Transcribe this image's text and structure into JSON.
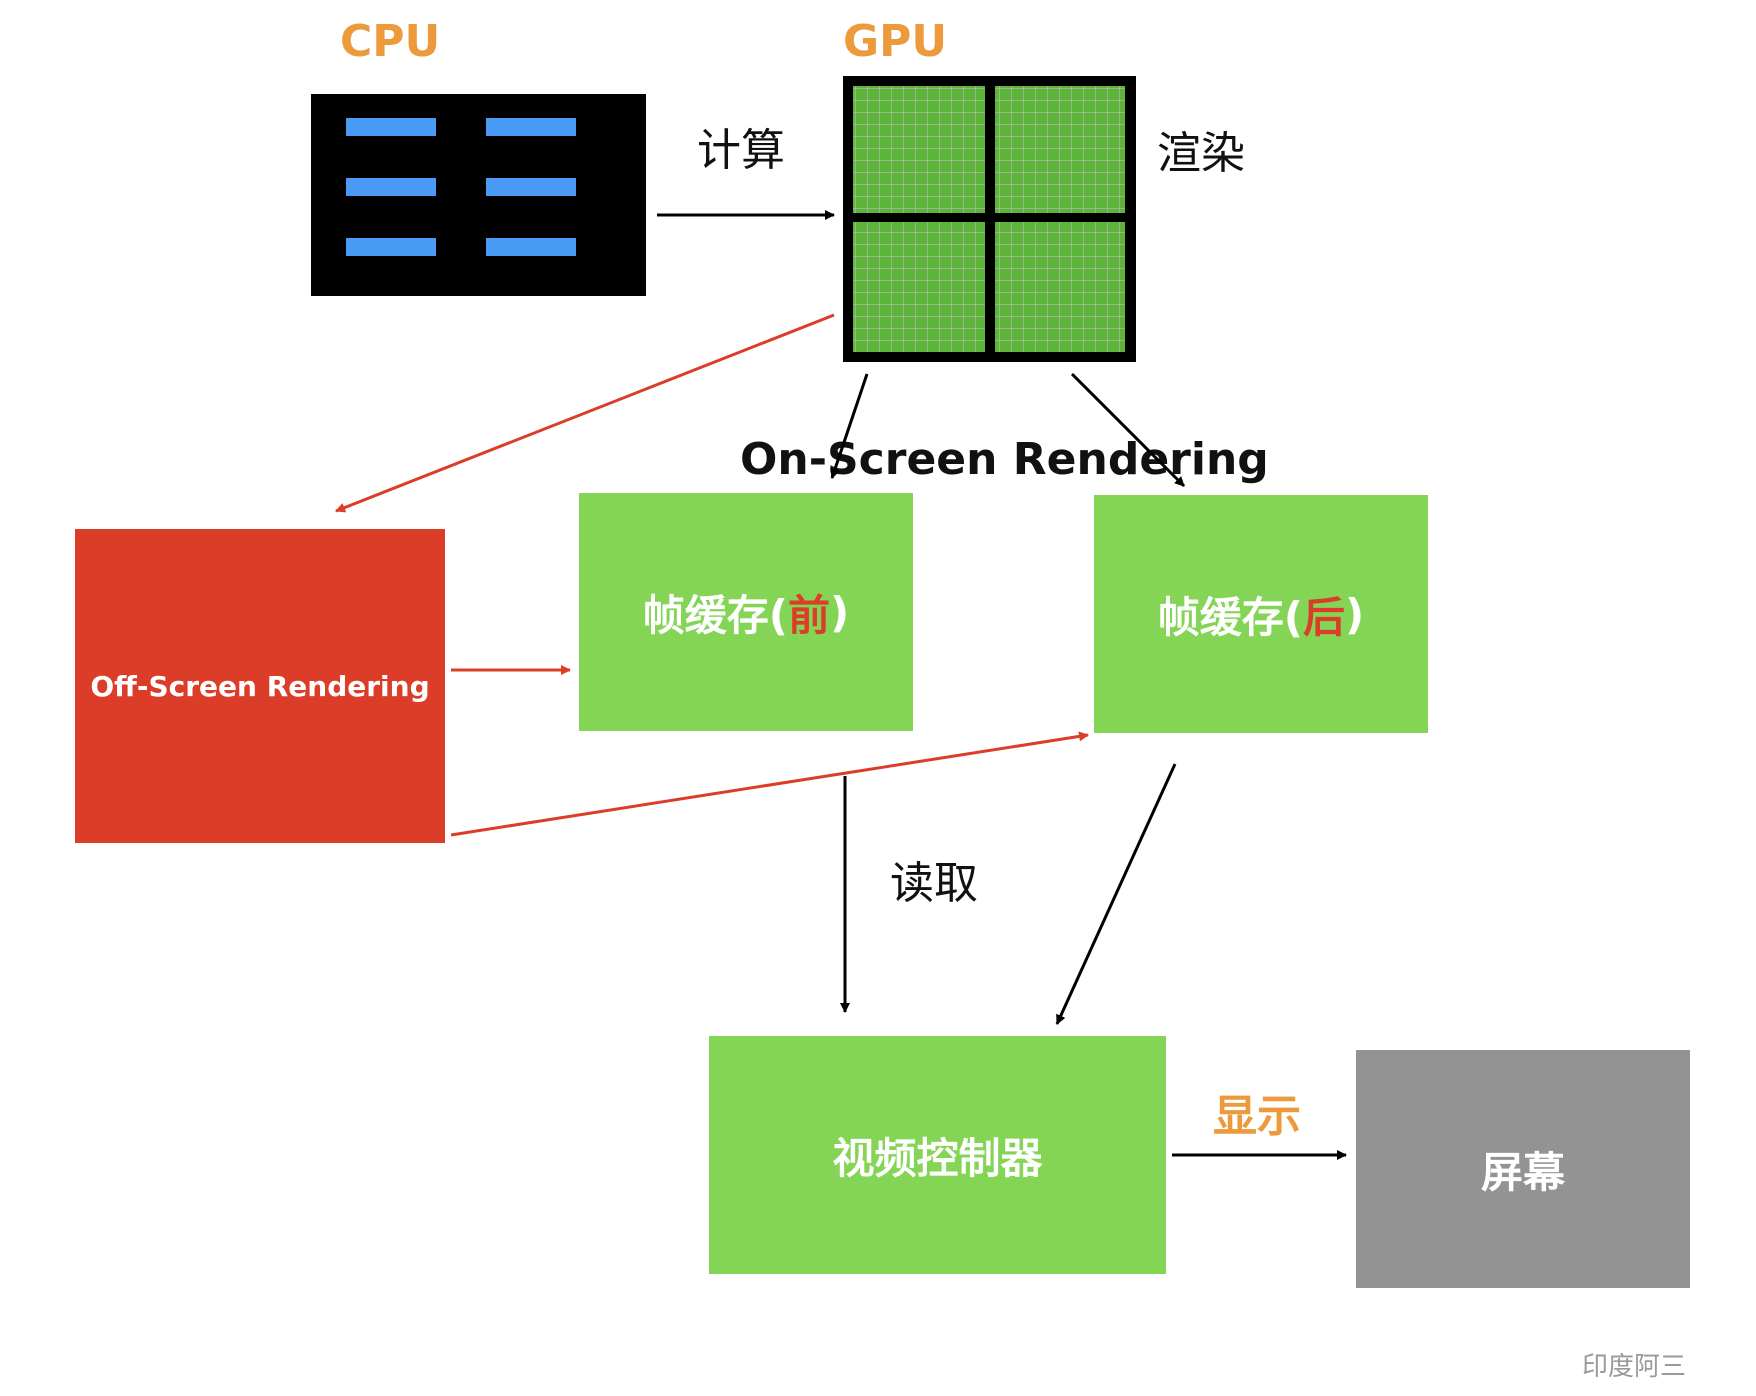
{
  "labels": {
    "cpu": "CPU",
    "gpu": "GPU",
    "compute": "计算",
    "render": "渲染",
    "on_screen": "On-Screen Rendering",
    "read": "读取",
    "display": "显示",
    "watermark": "印度阿三"
  },
  "boxes": {
    "off_screen": "Off-Screen Rendering",
    "front_buffer_prefix": "帧缓存(",
    "front_buffer_highlight": "前",
    "front_buffer_suffix": ")",
    "back_buffer_prefix": "帧缓存(",
    "back_buffer_highlight": "后",
    "back_buffer_suffix": ")",
    "video_controller": "视频控制器",
    "screen": "屏幕"
  },
  "colors": {
    "orange": "#EC9A3C",
    "green": "#84D455",
    "red": "#DB3D28",
    "gray": "#939393",
    "blue": "#4A9BF5",
    "gpu_grid_green": "#5DB63A"
  }
}
